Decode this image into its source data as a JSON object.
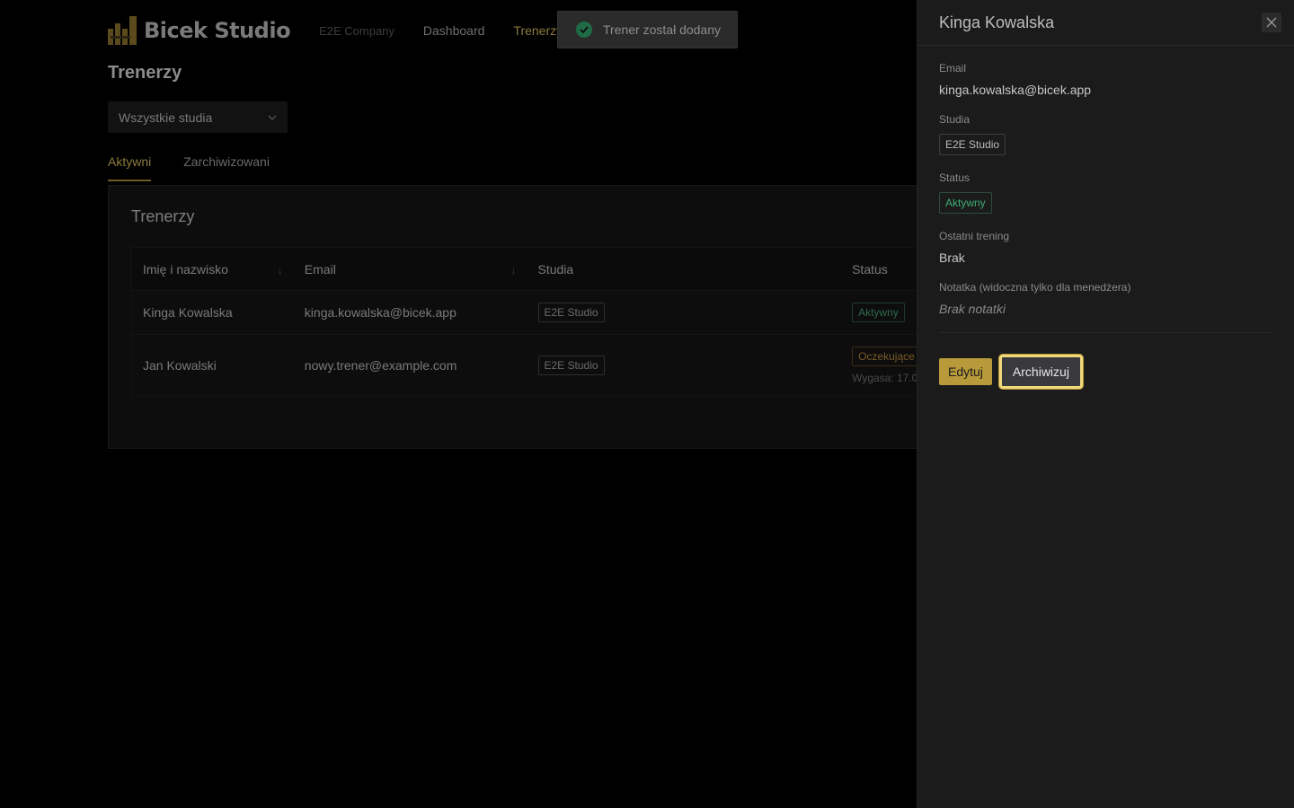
{
  "header": {
    "brand": "Bicek Studio",
    "company": "E2E Company",
    "nav": [
      {
        "label": "Dashboard"
      },
      {
        "label": "Trenerzy"
      }
    ]
  },
  "page": {
    "title": "Trenerzy",
    "studio_filter": "Wszystkie studia",
    "tabs": [
      {
        "label": "Aktywni",
        "active": true
      },
      {
        "label": "Zarchiwizowani",
        "active": false
      }
    ]
  },
  "table": {
    "title": "Trenerzy",
    "columns": [
      "Imię i nazwisko",
      "Email",
      "Studia",
      "Status"
    ],
    "rows": [
      {
        "name": "Kinga Kowalska",
        "email": "kinga.kowalska@bicek.app",
        "studio": "E2E Studio",
        "status": "Aktywny",
        "expires": ""
      },
      {
        "name": "Jan Kowalski",
        "email": "nowy.trener@example.com",
        "studio": "E2E Studio",
        "status": "Oczekujące",
        "expires": "Wygasa: 17.0"
      }
    ]
  },
  "toast": {
    "message": "Trener został dodany",
    "icon": "check-circle-icon",
    "color": "#1f6b45"
  },
  "drawer": {
    "title": "Kinga Kowalska",
    "fields": {
      "email_label": "Email",
      "email_value": "kinga.kowalska@bicek.app",
      "studio_label": "Studia",
      "studio_value": "E2E Studio",
      "status_label": "Status",
      "status_value": "Aktywny",
      "last_training_label": "Ostatni trening",
      "last_training_value": "Brak",
      "note_label": "Notatka (widoczna tylko dla menedżera)",
      "note_value": "Brak notatki"
    },
    "edit_label": "Edytuj",
    "archive_label": "Archiwizuj"
  },
  "colors": {
    "accent": "#b89a3a",
    "status_active": "#3fae75",
    "status_pending": "#7a5a28",
    "focus_ring": "#f0d77a"
  }
}
